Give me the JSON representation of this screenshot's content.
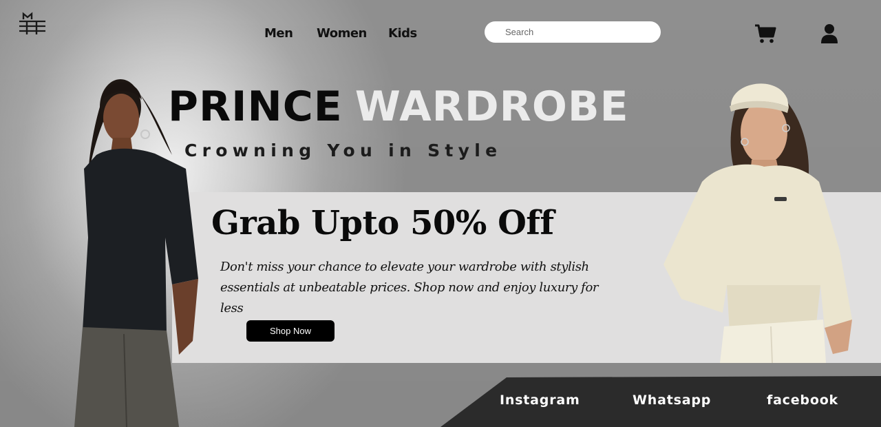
{
  "nav": {
    "items": [
      "Men",
      "Women",
      "Kids"
    ]
  },
  "search": {
    "placeholder": "Search"
  },
  "hero": {
    "brand_part1": "PRINCE",
    "brand_part2": "WARDROBE",
    "tagline": "Crowning You in Style"
  },
  "promo": {
    "title": "Grab Upto 50% Off",
    "text": "Don't miss your chance to elevate your wardrobe with stylish essentials at unbeatable prices. Shop now and enjoy luxury for less",
    "button_label": "Shop Now"
  },
  "social": {
    "items": [
      "Instagram",
      "Whatsapp",
      "facebook"
    ]
  },
  "icons": {
    "logo": "crown-monogram-logo",
    "cart": "shopping-cart-icon",
    "user": "user-icon"
  },
  "colors": {
    "band": "#e0dfdf",
    "social_bar": "#2b2b2b",
    "brand_light": "#ebebeb",
    "button": "#000000"
  }
}
